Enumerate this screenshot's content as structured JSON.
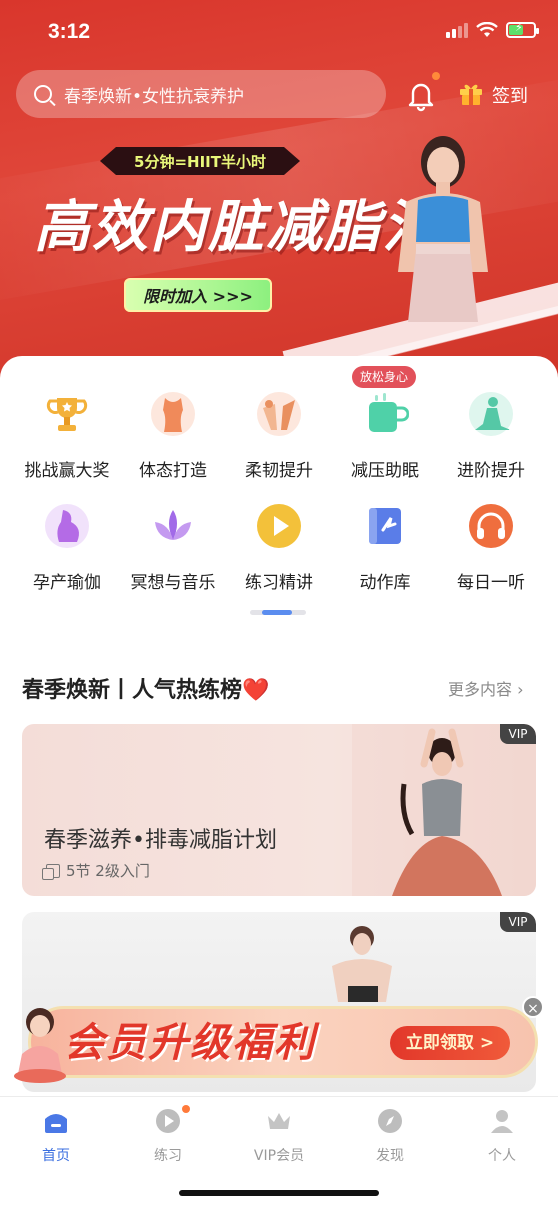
{
  "status_bar": {
    "time": "3:12"
  },
  "header": {
    "search_placeholder": "春季焕新•女性抗衰养护",
    "signin_label": "签到"
  },
  "banner": {
    "tag": "5分钟=HIIT半小时",
    "title": "高效内脏减脂法",
    "cta": "限时加入 >>>"
  },
  "categories": [
    {
      "label": "挑战赢大奖",
      "icon": "trophy-icon",
      "color": "#f3b13a"
    },
    {
      "label": "体态打造",
      "icon": "body-shape-icon",
      "color": "#f08a5a"
    },
    {
      "label": "柔韧提升",
      "icon": "stretch-icon",
      "color": "#e9905f"
    },
    {
      "label": "减压助眠",
      "icon": "cup-icon",
      "color": "#4fd1a8",
      "badge": "放松身心"
    },
    {
      "label": "进阶提升",
      "icon": "yoga-pose-icon",
      "color": "#55c8a6"
    },
    {
      "label": "孕产瑜伽",
      "icon": "pregnancy-icon",
      "color": "#b46be6"
    },
    {
      "label": "冥想与音乐",
      "icon": "lotus-icon",
      "color": "#a16ae8"
    },
    {
      "label": "练习精讲",
      "icon": "play-icon",
      "color": "#f3c13a"
    },
    {
      "label": "动作库",
      "icon": "book-icon",
      "color": "#5a7de8"
    },
    {
      "label": "每日一听",
      "icon": "headphones-icon",
      "color": "#ef6e3e"
    }
  ],
  "section": {
    "title": "春季焕新丨人气热练榜❤️",
    "more": "更多内容 ›"
  },
  "cards": [
    {
      "vip": "VIP",
      "title": "春季滋养•排毒减脂计划",
      "meta": "5节  2级入门"
    },
    {
      "vip": "VIP"
    }
  ],
  "upgrade": {
    "title": "会员升级福利",
    "cta": "立即领取 >",
    "close": "×"
  },
  "tabs": [
    {
      "label": "首页",
      "icon": "home-icon",
      "active": true
    },
    {
      "label": "练习",
      "icon": "practice-play-icon"
    },
    {
      "label": "VIP会员",
      "icon": "crown-icon"
    },
    {
      "label": "发现",
      "icon": "compass-icon"
    },
    {
      "label": "个人",
      "icon": "person-icon"
    }
  ],
  "colors": {
    "brand_red": "#d9362c",
    "accent_blue": "#3b6fe0"
  }
}
